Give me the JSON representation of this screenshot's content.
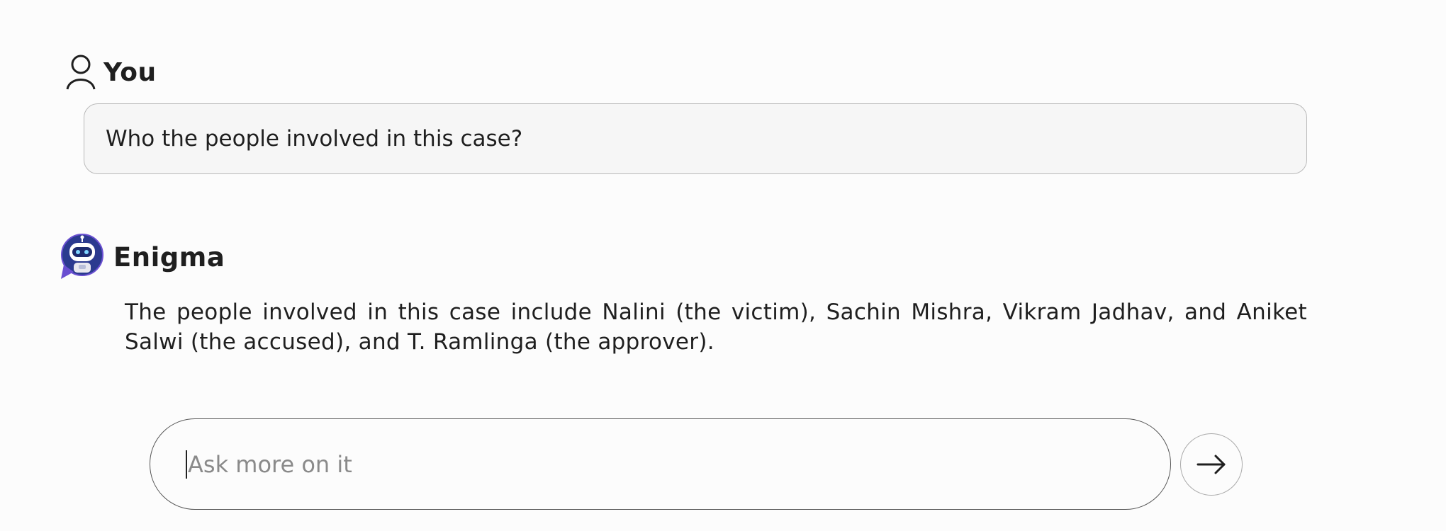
{
  "conversation": {
    "user": {
      "name": "You",
      "icon": "user-outline-icon",
      "message": "Who the people involved in this case?"
    },
    "assistant": {
      "name": "Enigma",
      "avatar": "robot-chat-bubble-avatar",
      "message": "The people involved in this case include Nalini (the victim), Sachin Mishra, Vikram Jadhav, and Aniket Salwi (the accused), and T. Ramlinga (the approver)."
    }
  },
  "composer": {
    "placeholder": "Ask more on it",
    "value": "",
    "send_icon": "arrow-right-icon"
  },
  "colors": {
    "background": "#fcfcfc",
    "bubble": "#f6f6f6",
    "avatar_primary": "#2b3a8f",
    "avatar_accent": "#6a4fd1"
  }
}
